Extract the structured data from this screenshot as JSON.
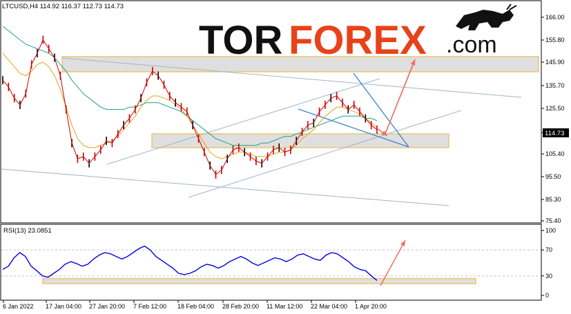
{
  "chart_data": [
    {
      "type": "line",
      "header": "LTCUSD,H4  114.92 116.37 112.73 114.73",
      "symbol": "LTCUSD",
      "timeframe": "H4",
      "ohlc": {
        "open": 114.92,
        "high": 116.37,
        "low": 112.73,
        "close": 114.73
      },
      "current_price": "114.73",
      "ylim": [
        75.4,
        166.0
      ],
      "y_ticks": [
        "166.00",
        "155.80",
        "145.90",
        "135.70",
        "125.50",
        "114.73",
        "105.40",
        "95.50",
        "85.30",
        "75.40"
      ],
      "x_ticks": [
        "6 Jan 2022",
        "17 Jan 04:00",
        "27 Jan 20:00",
        "7 Feb 12:00",
        "18 Feb 04:00",
        "28 Feb 20:00",
        "11 Mar 12:00",
        "22 Mar 04:00",
        "1 Apr 20:00"
      ],
      "series": [
        {
          "name": "Price",
          "color": "#cc0000",
          "values": [
            138,
            135,
            130,
            127,
            132,
            145,
            150,
            156,
            152,
            148,
            140,
            125,
            110,
            103,
            104,
            101,
            104,
            107,
            111,
            110,
            114,
            118,
            121,
            125,
            130,
            137,
            142,
            140,
            136,
            131,
            128,
            126,
            124,
            118,
            112,
            106,
            100,
            96,
            98,
            103,
            107,
            108,
            106,
            104,
            102,
            101,
            104,
            107,
            108,
            106,
            107,
            111,
            115,
            118,
            119,
            124,
            127,
            130,
            131,
            128,
            125,
            127,
            124,
            121,
            118,
            116
          ]
        },
        {
          "name": "MA fast",
          "color": "#e6a020",
          "values": [
            150,
            147,
            144,
            141,
            140,
            142,
            145,
            146,
            144,
            140,
            134,
            126,
            118,
            112,
            109,
            108,
            108,
            109,
            110,
            111,
            113,
            116,
            119,
            122,
            126,
            129,
            131,
            131,
            130,
            129,
            127,
            125,
            122,
            118,
            114,
            110,
            106,
            104,
            103,
            104,
            105,
            106,
            106,
            105,
            104,
            104,
            104,
            105,
            106,
            106,
            107,
            109,
            112,
            114,
            116,
            119,
            122,
            124,
            126,
            126,
            125,
            124,
            123,
            121,
            119,
            117
          ]
        },
        {
          "name": "MA slow",
          "color": "#20a090",
          "values": [
            162,
            160,
            158,
            156,
            154,
            153,
            152,
            151,
            150,
            148,
            145,
            142,
            138,
            135,
            132,
            130,
            128,
            126,
            125,
            125,
            125,
            125,
            126,
            126,
            127,
            128,
            128,
            128,
            127,
            126,
            125,
            124,
            122,
            120,
            118,
            116,
            114,
            112,
            111,
            110,
            109,
            109,
            109,
            109,
            109,
            110,
            110,
            111,
            112,
            113,
            113,
            114,
            115,
            116,
            117,
            118,
            119,
            120,
            121,
            122,
            122,
            122,
            122,
            121,
            121,
            120
          ]
        }
      ],
      "annotations": {
        "support_zone": [
          109.5,
          113.5
        ],
        "resistance_zone": [
          144.0,
          150.0
        ],
        "forecast_arrow": "up"
      }
    },
    {
      "type": "line",
      "header": "RSI(13) 23.0851",
      "name": "RSI(13)",
      "current_value": 23.0851,
      "ylim": [
        0,
        100
      ],
      "y_ticks": [
        "100",
        "70",
        "30",
        "0"
      ],
      "series": [
        {
          "name": "RSI(13)",
          "color": "#0000dd",
          "values": [
            40,
            45,
            58,
            66,
            60,
            45,
            38,
            30,
            28,
            34,
            40,
            48,
            52,
            49,
            45,
            48,
            56,
            62,
            66,
            64,
            60,
            56,
            60,
            66,
            72,
            76,
            70,
            60,
            54,
            48,
            42,
            34,
            32,
            34,
            38,
            44,
            48,
            46,
            42,
            46,
            52,
            56,
            60,
            56,
            50,
            46,
            50,
            54,
            58,
            56,
            52,
            56,
            62,
            64,
            60,
            56,
            54,
            62,
            66,
            64,
            58,
            52,
            44,
            40,
            38,
            30,
            23
          ]
        }
      ],
      "annotations": {
        "oversold_zone": [
          26,
          18
        ],
        "forecast_arrow": "up"
      }
    }
  ],
  "watermark": {
    "part1": "TOR",
    "part2": "FOREX",
    "part3": ".com"
  },
  "colors": {
    "price": "#cc0000",
    "ma_fast": "#e6a020",
    "ma_slow": "#20a090",
    "rsi": "#0000dd",
    "channel": "#9fb4cc",
    "wedge": "#3a7fd0",
    "arrow": "#f07060",
    "zone_fill": "#dcdcdc",
    "zone_border": "#e8c060"
  }
}
